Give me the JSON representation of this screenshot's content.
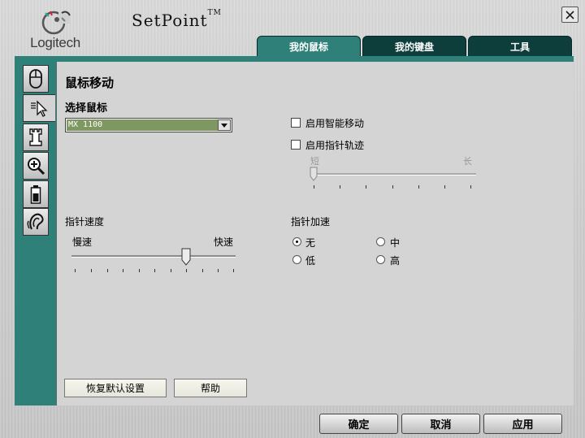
{
  "header": {
    "logo_text": "Logitech",
    "app_title": "SetPoint",
    "app_title_mark": "TM"
  },
  "tabs": [
    {
      "label": "我的鼠标",
      "active": true
    },
    {
      "label": "我的键盘",
      "active": false
    },
    {
      "label": "工具",
      "active": false
    }
  ],
  "side_tabs": [
    {
      "icon": "mouse-icon"
    },
    {
      "icon": "pointer-icon",
      "active": true
    },
    {
      "icon": "chess-rook-icon"
    },
    {
      "icon": "zoom-in-icon"
    },
    {
      "icon": "battery-icon"
    },
    {
      "icon": "ear-sound-icon"
    }
  ],
  "main": {
    "section_title": "鼠标移动",
    "select_mouse_label": "选择鼠标",
    "select_mouse_value": "MX 1100",
    "smart_move_label": "启用智能移动",
    "smart_move_checked": false,
    "pointer_trail_label": "启用指针轨迹",
    "pointer_trail_checked": false,
    "trail_short_label": "短",
    "trail_long_label": "长",
    "trail_level": 0,
    "pointer_speed_label": "指针速度",
    "speed_slow_label": "慢速",
    "speed_fast_label": "快速",
    "pointer_speed_level": 0.7,
    "pointer_accel_label": "指针加速",
    "accel_options": [
      {
        "label": "无",
        "selected": true
      },
      {
        "label": "中",
        "selected": false
      },
      {
        "label": "低",
        "selected": false
      },
      {
        "label": "高",
        "selected": false
      }
    ],
    "restore_defaults_label": "恢复默认设置",
    "help_label": "帮助"
  },
  "footer": {
    "ok_label": "确定",
    "cancel_label": "取消",
    "apply_label": "应用"
  },
  "colors": {
    "accent": "#2f8079",
    "tab_dark": "#0d3e3c",
    "select_highlight": "#7f9760"
  }
}
